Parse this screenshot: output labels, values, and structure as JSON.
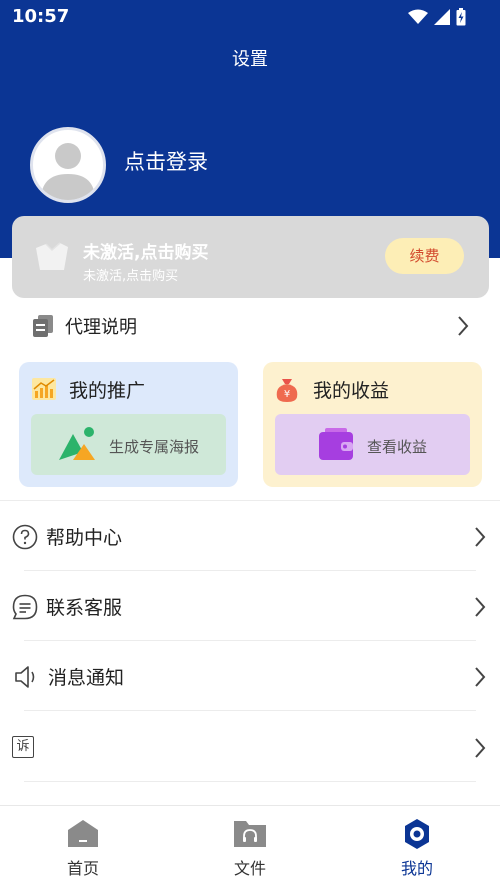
{
  "status_bar": {
    "time": "10:57"
  },
  "header": {
    "title": "设置",
    "login_text": "点击登录"
  },
  "vip_card": {
    "title": "未激活,点击购买",
    "subtitle": "未激活,点击购买",
    "renew_label": "续费"
  },
  "agent": {
    "label": "代理说明"
  },
  "cards": {
    "promo": {
      "title": "我的推广",
      "action_label": "生成专属海报"
    },
    "earnings": {
      "title": "我的收益",
      "action_label": "查看收益"
    }
  },
  "menu": [
    {
      "label": "帮助中心",
      "icon": "help-icon"
    },
    {
      "label": "联系客服",
      "icon": "chat-icon"
    },
    {
      "label": "消息通知",
      "icon": "speaker-icon"
    },
    {
      "label": "",
      "icon": "complaint-icon",
      "icon_text": "诉"
    }
  ],
  "tabs": [
    {
      "label": "首页",
      "icon": "home-icon",
      "active": false
    },
    {
      "label": "文件",
      "icon": "folder-icon",
      "active": false
    },
    {
      "label": "我的",
      "icon": "settings-icon",
      "active": true
    }
  ],
  "colors": {
    "brand": "#0b3594",
    "renew_text": "#d24a2d",
    "renew_bg": "#fdeeb6"
  }
}
